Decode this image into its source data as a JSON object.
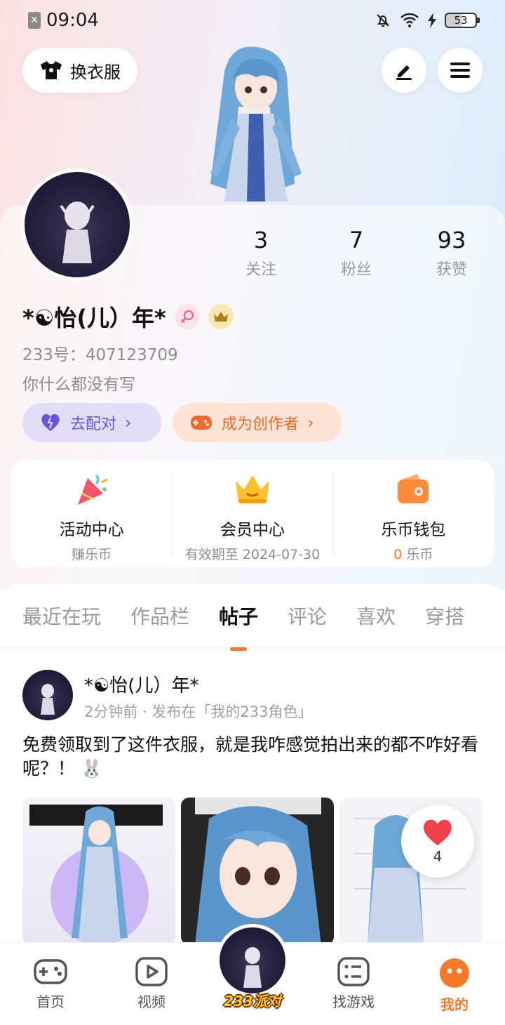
{
  "status_bar": {
    "time": "09:04",
    "battery": "53"
  },
  "header": {
    "outfit_button": "换衣服",
    "edit_icon": "pencil-icon",
    "menu_icon": "hamburger-menu-icon"
  },
  "stats": [
    {
      "value": "3",
      "label": "关注"
    },
    {
      "value": "7",
      "label": "粉丝"
    },
    {
      "value": "93",
      "label": "获赞"
    }
  ],
  "profile": {
    "name": "*☯怡(儿）年*",
    "id_line": "233号：407123709",
    "bio": "你什么都没有写",
    "gender_badge_icon": "female-symbol-icon",
    "vip_badge_icon": "crown-badge-icon"
  },
  "actions": {
    "match": "去配对",
    "creator": "成为创作者"
  },
  "quick_links": [
    {
      "title": "活动中心",
      "sub": "赚乐币",
      "icon": "party-popper-icon"
    },
    {
      "title": "会员中心",
      "sub": "有效期至 2024-07-30",
      "icon": "crown-icon"
    },
    {
      "title": "乐币钱包",
      "sub_num": "0",
      "sub_unit": "乐币",
      "icon": "wallet-icon"
    }
  ],
  "tabs": [
    "最近在玩",
    "作品栏",
    "帖子",
    "评论",
    "喜欢",
    "穿搭"
  ],
  "active_tab": "帖子",
  "post": {
    "author": "*☯怡(儿）年*",
    "meta": "2分钟前 · 发布在「我的233角色」",
    "text": "免费领取到了这件衣服，就是我咋感觉拍出来的都不咋好看呢？！ 🐰",
    "likes": "4"
  },
  "bottom_nav": [
    {
      "label": "首页",
      "icon": "gamepad-icon"
    },
    {
      "label": "视频",
      "icon": "video-play-icon"
    },
    {
      "label": "233派对",
      "icon": "party-avatar-icon"
    },
    {
      "label": "找游戏",
      "icon": "game-list-icon"
    },
    {
      "label": "我的",
      "icon": "profile-face-icon"
    }
  ],
  "colors": {
    "accent": "#f47a2a",
    "match_purple": "#6a55d8",
    "match_bg": "#e3def8",
    "creator_bg": "#fde3d6"
  }
}
